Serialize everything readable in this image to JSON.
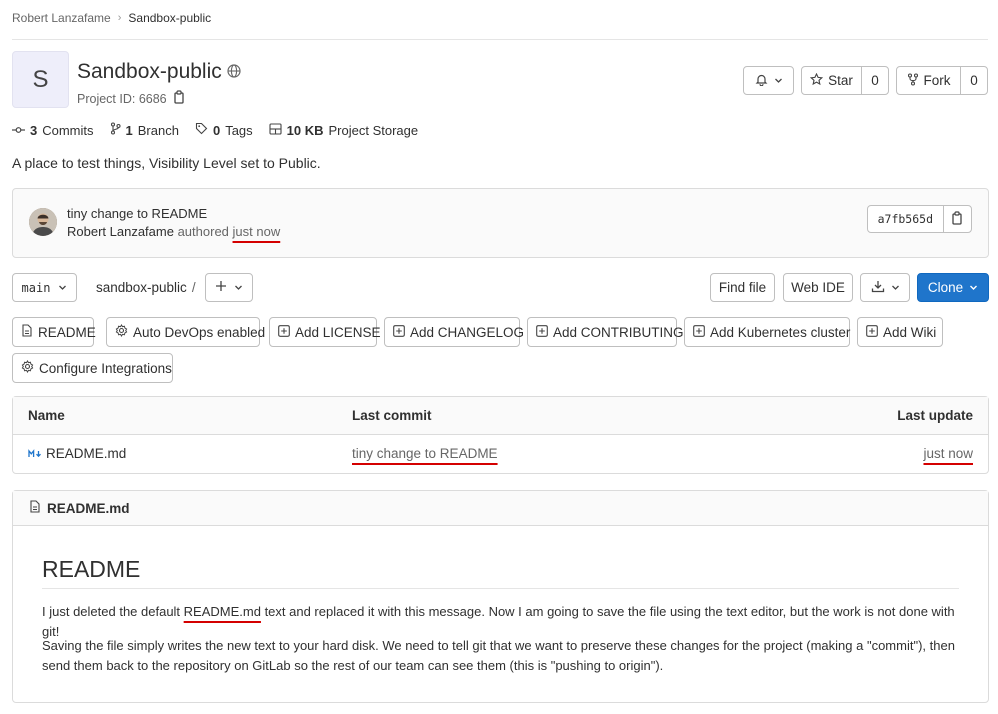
{
  "breadcrumb": {
    "owner": "Robert Lanzafame",
    "project": "Sandbox-public"
  },
  "project": {
    "initial": "S",
    "name": "Sandbox-public",
    "id_label": "Project ID: 6686",
    "description": "A place to test things, Visibility Level set to Public."
  },
  "actions": {
    "star_label": "Star",
    "star_count": "0",
    "fork_label": "Fork",
    "fork_count": "0"
  },
  "stats": {
    "commits_count": "3",
    "commits_label": "Commits",
    "branch_count": "1",
    "branch_label": "Branch",
    "tags_count": "0",
    "tags_label": "Tags",
    "storage_size": "10 KB",
    "storage_label": "Project Storage"
  },
  "last_commit": {
    "title": "tiny change to README",
    "author": "Robert Lanzafame",
    "authored": "authored",
    "time": "just now",
    "sha": "a7fb565d"
  },
  "branch": {
    "name": "main",
    "path": "sandbox-public",
    "slash": "/"
  },
  "toolbar": {
    "find_file": "Find file",
    "web_ide": "Web IDE",
    "clone": "Clone"
  },
  "pills": {
    "readme": "README",
    "autodevops": "Auto DevOps enabled",
    "license": "Add LICENSE",
    "changelog": "Add CHANGELOG",
    "contributing": "Add CONTRIBUTING",
    "kubernetes": "Add Kubernetes cluster",
    "wiki": "Add Wiki",
    "integrations": "Configure Integrations"
  },
  "table": {
    "headers": {
      "name": "Name",
      "last_commit": "Last commit",
      "last_update": "Last update"
    },
    "rows": [
      {
        "name": "README.md",
        "commit": "tiny change to README",
        "updated": "just now"
      }
    ]
  },
  "readme": {
    "file": "README.md",
    "heading": "README",
    "p1_before": "I just deleted the default ",
    "p1_link": "README.md",
    "p1_after": " text and replaced it with this message. Now I am going to save the file using the text editor, but the work is not done with git!",
    "p2": "Saving the file simply writes the new text to your hard disk. We need to tell git that we want to preserve these changes for the project (making a \"commit\"), then send them back to the repository on GitLab so the rest of our team can see them (this is \"pushing to origin\")."
  },
  "colors": {
    "primary": "#1f75cb",
    "annotation": "#d40000",
    "markdown_icon": "#1f75cb"
  }
}
